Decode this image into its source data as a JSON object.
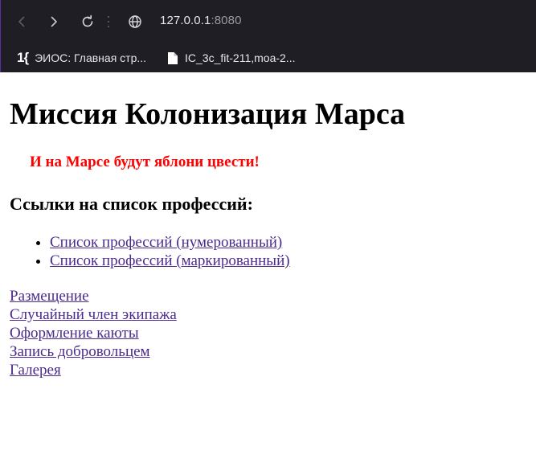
{
  "browser": {
    "url_host": "127.0.0.1",
    "url_port": ":8080",
    "bookmarks": [
      {
        "icon": "eios-logo-icon",
        "logo_text": "1{",
        "label": "ЭИОС: Главная стр..."
      },
      {
        "icon": "file-icon",
        "label": "IC_3c_fit-211,moa-2..."
      }
    ]
  },
  "page": {
    "title": "Миссия Колонизация Марса",
    "slogan": "И на Марсе будут яблони цвести!",
    "professions_heading": "Ссылки на список профессий:",
    "profession_links": [
      "Список профессий (нумерованный)",
      "Список профессий (маркированный)"
    ],
    "nav_links": [
      "Размещение",
      "Случайный член экипажа",
      "Оформление каюты",
      "Запись добровольцем",
      "Галерея"
    ],
    "colors": {
      "chrome_bg": "#1f1e24",
      "slogan": "#ff0000",
      "link": "#4b2a8e"
    }
  }
}
